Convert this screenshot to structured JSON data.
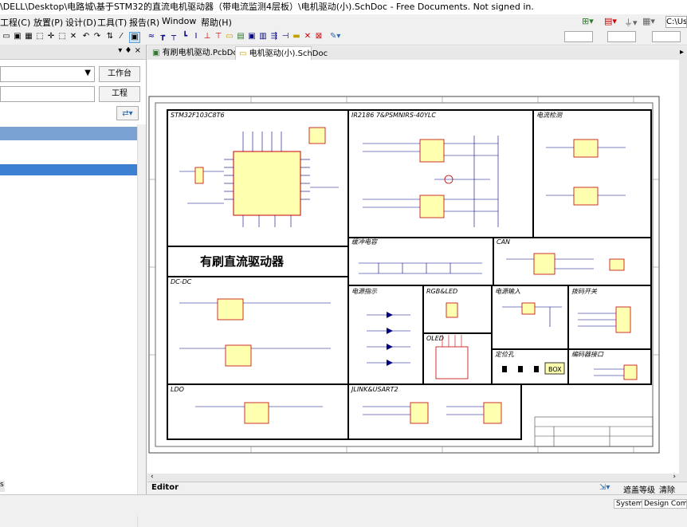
{
  "window": {
    "title": "\\DELL\\Desktop\\电路城\\基于STM32的直流电机驱动器（带电流监测4层板）\\电机驱动(小).SchDoc - Free Documents. Not signed in."
  },
  "menu": [
    "工程(C)",
    "放置(P)",
    "设计(D)",
    "工具(T)",
    "报告(R)",
    "Window",
    "帮助(H)"
  ],
  "toolbar_right": {
    "path": "C:\\Us"
  },
  "left_panel": {
    "pin": "▾ ♦ ×",
    "workspace_btn": "工作台",
    "project_btn": "工程"
  },
  "tabs": [
    {
      "label": "有刷电机驱动.PcbDoc *",
      "active": false
    },
    {
      "label": "电机驱动(小).SchDoc",
      "active": true
    }
  ],
  "schematic": {
    "blocks": {
      "mcu": "STM32F103C8T6",
      "bridge": "IR2186 7&PSMNIRS-40YLC",
      "current": "电流检测",
      "buffer": "缓冲电容",
      "can": "CAN",
      "dcdc": "DC-DC",
      "power_ind": "电源指示",
      "rgb": "RGB&LED",
      "power_in": "电源输入",
      "dip": "拨码开关",
      "oled": "OLED",
      "mount": "定位孔",
      "encoder": "编码器接口",
      "ldo": "LDO",
      "jlink": "JLINK&USART2"
    },
    "title": "有刷直流驱动器",
    "box_label": "BOX"
  },
  "editor_tab": "Editor",
  "bottom_right": {
    "mask": "遮盖等级",
    "clear": "清除"
  },
  "status": {
    "system": "System",
    "design": "Design Compil"
  },
  "colors": {
    "wire": "#000080",
    "part": "#c00000",
    "fill": "#ffffb0",
    "border": "#000000"
  }
}
